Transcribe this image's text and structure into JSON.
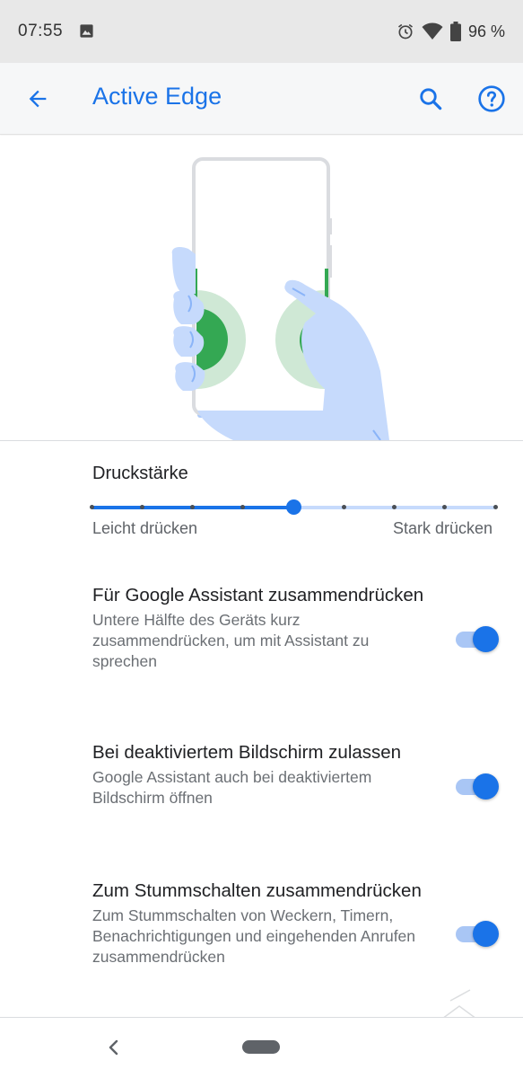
{
  "status_bar": {
    "time": "07:55",
    "battery_text": "96 %",
    "icons": [
      "image-icon",
      "alarm-icon",
      "wifi-icon",
      "battery-icon"
    ]
  },
  "app_bar": {
    "title": "Active Edge",
    "icons": [
      "back-arrow-icon",
      "search-icon",
      "help-icon"
    ],
    "accent_color": "#1a73e8"
  },
  "pressure": {
    "title": "Druckstärke",
    "min_label": "Leicht drücken",
    "max_label": "Stark drücken",
    "steps": 9,
    "value": 5
  },
  "settings": [
    {
      "title": "Für Google Assistant zusammendrücken",
      "summary": "Untere Hälfte des Geräts kurz zusammendrücken, um mit Assistant zu sprechen",
      "enabled": true
    },
    {
      "title": "Bei deaktiviertem Bildschirm zulassen",
      "summary": "Google Assistant auch bei deaktiviertem Bildschirm öffnen",
      "enabled": true
    },
    {
      "title": "Zum Stummschalten zusammendrücken",
      "summary": "Zum Stummschalten von Weckern, Timern, Benachrichtigungen und eingehenden Anrufen zusammendrücken",
      "enabled": true
    }
  ],
  "nav_bar": {
    "icons": [
      "nav-back-icon",
      "nav-home-pill"
    ]
  }
}
